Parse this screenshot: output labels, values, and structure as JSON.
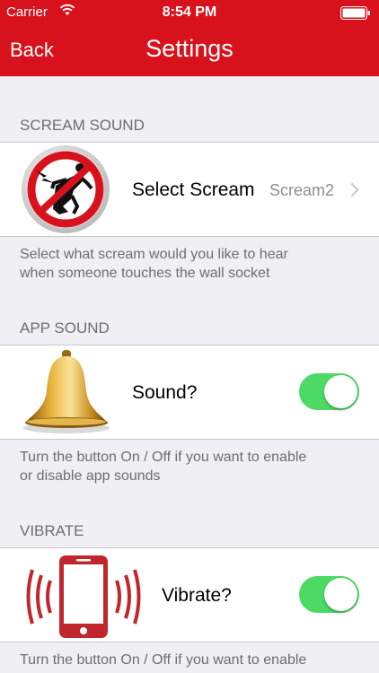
{
  "status_bar": {
    "carrier": "Carrier",
    "time": "8:54 PM"
  },
  "nav": {
    "back_label": "Back",
    "title": "Settings"
  },
  "sections": {
    "scream": {
      "header": "SCREAM SOUND",
      "label": "Select Scream",
      "detail": "Scream2",
      "footer_line1": "Select what scream would you like to hear",
      "footer_line2": "when someone touches the wall socket"
    },
    "app_sound": {
      "header": "APP SOUND",
      "label": "Sound?",
      "toggle_on": true,
      "footer_line1": "Turn the button On / Off if you want to enable",
      "footer_line2": "or disable app sounds"
    },
    "vibrate": {
      "header": "VIBRATE",
      "label": "Vibrate?",
      "toggle_on": true,
      "footer_line1": "Turn the button On / Off if you want to enable"
    }
  },
  "colors": {
    "nav_bar": "#d8121c",
    "toggle_on": "#4cd964",
    "background": "#efeff4"
  },
  "icons": [
    "wifi-icon",
    "battery-icon",
    "no-electric-shock-icon",
    "bell-icon",
    "vibrating-phone-icon",
    "chevron-right-icon"
  ]
}
